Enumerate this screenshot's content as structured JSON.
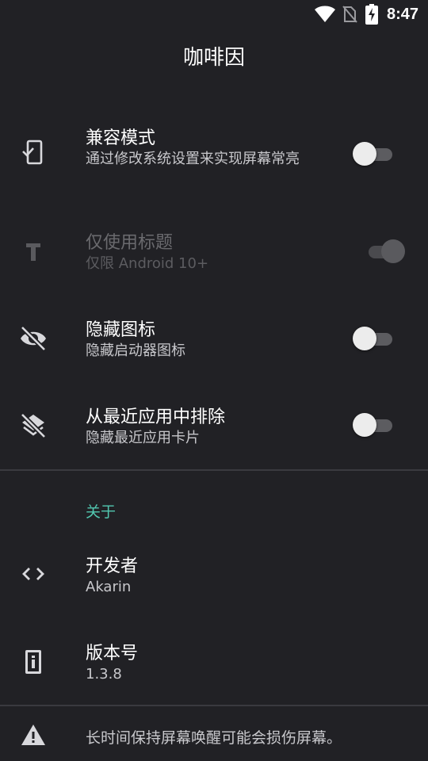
{
  "status_bar": {
    "time": "8:47",
    "icons": [
      "wifi-icon",
      "no-sim-icon",
      "battery-charging-icon"
    ]
  },
  "app_bar": {
    "title": "咖啡因"
  },
  "settings": {
    "compat_mode": {
      "title": "兼容模式",
      "subtitle": "通过修改系统设置来实现屏幕常亮",
      "icon": "phone-check-icon",
      "enabled": false
    },
    "title_only": {
      "title": "仅使用标题",
      "subtitle": "仅限 Android 10+",
      "icon": "text-t-icon",
      "enabled": true,
      "disabled": true
    },
    "hide_icon": {
      "title": "隐藏图标",
      "subtitle": "隐藏启动器图标",
      "icon": "eye-off-icon",
      "enabled": false
    },
    "exclude_recents": {
      "title": "从最近应用中排除",
      "subtitle": "隐藏最近应用卡片",
      "icon": "layers-off-icon",
      "enabled": false
    }
  },
  "about": {
    "header": "关于",
    "developer": {
      "title": "开发者",
      "value": "Akarin",
      "icon": "code-icon"
    },
    "version": {
      "title": "版本号",
      "value": "1.3.8",
      "icon": "info-device-icon"
    }
  },
  "footer": {
    "warning": "长时间保持屏幕唤醒可能会损伤屏幕。",
    "icon": "warning-icon"
  },
  "colors": {
    "background": "#212125",
    "accent": "#52c7b0",
    "divider": "#3a3a3f"
  }
}
